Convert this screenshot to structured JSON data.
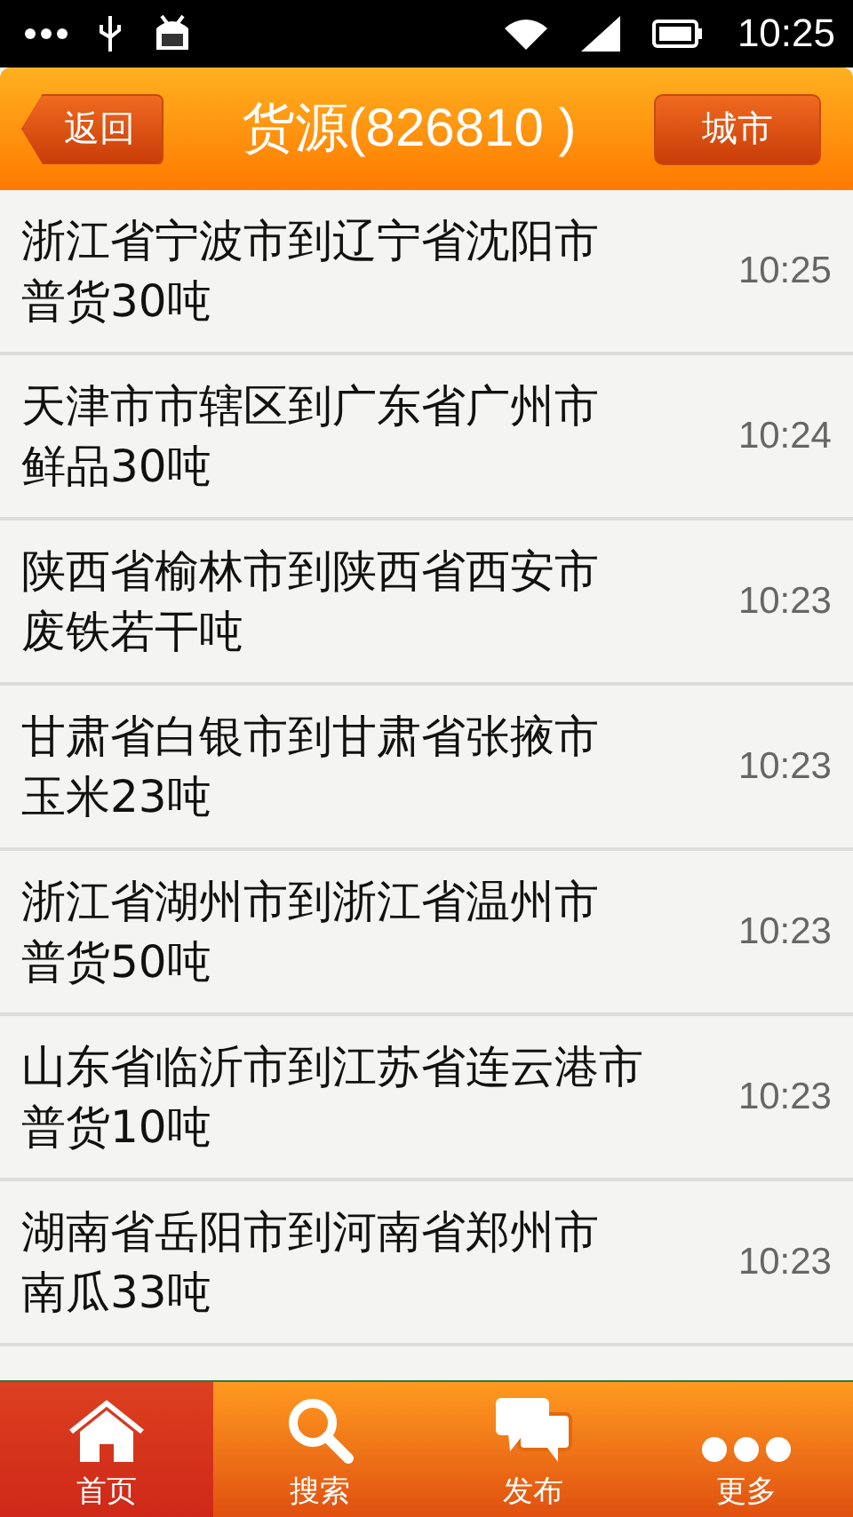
{
  "status_bar": {
    "time": "10:25"
  },
  "header": {
    "back": "返回",
    "title": "货源(826810 )",
    "action": "城市"
  },
  "rows": [
    {
      "route": "浙江省宁波市到辽宁省沈阳市",
      "cargo": "普货30吨",
      "time": "10:25"
    },
    {
      "route": "天津市市辖区到广东省广州市",
      "cargo": "鲜品30吨",
      "time": "10:24"
    },
    {
      "route": "陕西省榆林市到陕西省西安市",
      "cargo": "废铁若干吨",
      "time": "10:23"
    },
    {
      "route": "甘肃省白银市到甘肃省张掖市",
      "cargo": "玉米23吨",
      "time": "10:23"
    },
    {
      "route": "浙江省湖州市到浙江省温州市",
      "cargo": "普货50吨",
      "time": "10:23"
    },
    {
      "route": "山东省临沂市到江苏省连云港市",
      "cargo": "普货10吨",
      "time": "10:23"
    },
    {
      "route": "湖南省岳阳市到河南省郑州市",
      "cargo": "南瓜33吨",
      "time": "10:23"
    }
  ],
  "tabs": [
    {
      "label": "首页",
      "kind": "home",
      "selected": true
    },
    {
      "label": "搜索",
      "kind": "search",
      "selected": false
    },
    {
      "label": "发布",
      "kind": "chat",
      "selected": false
    },
    {
      "label": "更多",
      "kind": "more",
      "selected": false
    }
  ]
}
